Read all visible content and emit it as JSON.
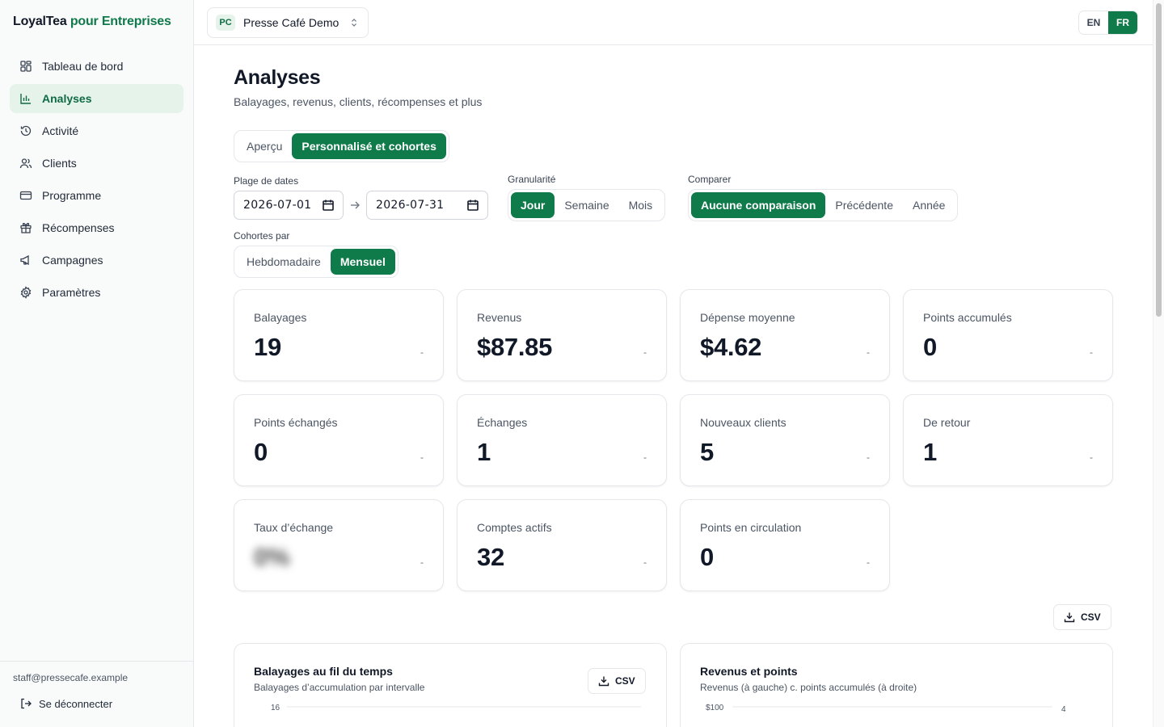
{
  "brand": {
    "name": "LoyalTea",
    "suffix": "pour Entreprises"
  },
  "sidebar": {
    "items": [
      {
        "label": "Tableau de bord",
        "icon": "dashboard-icon"
      },
      {
        "label": "Analyses",
        "icon": "bar-chart-icon",
        "active": true
      },
      {
        "label": "Activité",
        "icon": "history-icon"
      },
      {
        "label": "Clients",
        "icon": "users-icon"
      },
      {
        "label": "Programme",
        "icon": "card-icon"
      },
      {
        "label": "Récompenses",
        "icon": "gift-icon"
      },
      {
        "label": "Campagnes",
        "icon": "megaphone-icon"
      },
      {
        "label": "Paramètres",
        "icon": "gear-icon"
      }
    ],
    "email": "staff@pressecafe.example",
    "logout": "Se déconnecter"
  },
  "topbar": {
    "org_badge": "PC",
    "org_name": "Presse Café Demo",
    "lang": {
      "en": "EN",
      "fr": "FR",
      "active": "FR"
    }
  },
  "page": {
    "title": "Analyses",
    "subtitle": "Balayages, revenus, clients, récompenses et plus",
    "tabs": {
      "overview": "Aperçu",
      "custom": "Personnalisé et cohortes",
      "active": "custom"
    }
  },
  "filters": {
    "date_range_label": "Plage de dates",
    "date_from": "2026-07-01",
    "date_to": "2026-07-31",
    "granularity_label": "Granularité",
    "granularity": {
      "day": "Jour",
      "week": "Semaine",
      "month": "Mois",
      "active": "day"
    },
    "compare_label": "Comparer",
    "compare": {
      "none": "Aucune comparaison",
      "previous": "Précédente",
      "year": "Année",
      "active": "none"
    },
    "cohorts_label": "Cohortes par",
    "cohorts": {
      "weekly": "Hebdomadaire",
      "monthly": "Mensuel",
      "active": "monthly"
    }
  },
  "metrics": [
    {
      "title": "Balayages",
      "value": "19",
      "delta": "-"
    },
    {
      "title": "Revenus",
      "value": "$87.85",
      "delta": "-"
    },
    {
      "title": "Dépense moyenne",
      "value": "$4.62",
      "delta": "-"
    },
    {
      "title": "Points accumulés",
      "value": "0",
      "delta": "-"
    },
    {
      "title": "Points échangés",
      "value": "0",
      "delta": "-"
    },
    {
      "title": "Échanges",
      "value": "1",
      "delta": "-"
    },
    {
      "title": "Nouveaux clients",
      "value": "5",
      "delta": "-"
    },
    {
      "title": "De retour",
      "value": "1",
      "delta": "-"
    },
    {
      "title": "Taux d’échange",
      "value": "0%",
      "delta": "-"
    },
    {
      "title": "Comptes actifs",
      "value": "32",
      "delta": "-"
    },
    {
      "title": "Points en circulation",
      "value": "0",
      "delta": "-"
    }
  ],
  "csv_label": "CSV",
  "panels": {
    "swipes": {
      "title": "Balayages au fil du temps",
      "subtitle": "Balayages d’accumulation par intervalle",
      "y_top_tick": "16"
    },
    "revenue": {
      "title": "Revenus et points",
      "subtitle": "Revenus (à gauche) c. points accumulés (à droite)",
      "y_left_top_tick": "$100",
      "y_right_top_tick": "4"
    }
  },
  "colors": {
    "accent": "#0f7a4a",
    "accent_soft": "#e6f3ea"
  }
}
